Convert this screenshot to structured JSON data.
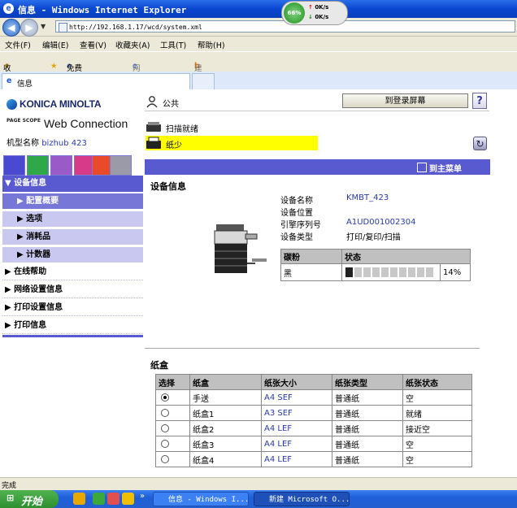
{
  "window": {
    "title": "信息 - Windows Internet Explorer",
    "address": "http://192.168.1.17/wcd/system.xml"
  },
  "speedmeter": {
    "percent": "66%",
    "up": "0K/s",
    "down": "0K/s"
  },
  "menu": [
    "文件(F)",
    "编辑(E)",
    "查看(V)",
    "收藏夹(A)",
    "工具(T)",
    "帮助(H)"
  ],
  "favorites": {
    "label": "收藏夹",
    "item1": "免费 Hotmail",
    "item2": "网页快讯库 ▾",
    "item3": "建议网站 ▾"
  },
  "tab": {
    "label": "信息"
  },
  "header": {
    "brand": "KONICA MINOLTA",
    "ps": "PAGE SCOPE",
    "wc": "Web Connection",
    "model_label": "机型名称",
    "model": "bizhub 423",
    "user": "公共",
    "login": "到登录屏幕",
    "help": "?"
  },
  "status": {
    "scan": "扫描就绪",
    "paper": "纸少"
  },
  "main_link": "到主菜单",
  "sidebar": {
    "device_info": "▼ 设备信息",
    "items": [
      "▶ 配置概要",
      "▶ 选项",
      "▶ 消耗品",
      "▶ 计数器"
    ],
    "online_help": "▶ 在线帮助",
    "network": "▶ 网络设置信息",
    "print_settings": "▶ 打印设置信息",
    "print_info": "▶ 打印信息"
  },
  "device": {
    "title": "设备信息",
    "fields": [
      {
        "label": "设备名称",
        "value": "KMBT_423"
      },
      {
        "label": "设备位置",
        "value": ""
      },
      {
        "label": "引擎序列号",
        "value": "A1UD001002304"
      },
      {
        "label": "设备类型",
        "value": "打印/复印/扫描"
      }
    ],
    "toner": {
      "h1": "碳粉",
      "h2": "状态",
      "color": "黑",
      "level": 0.14,
      "percent": "14%"
    }
  },
  "paper_tray": {
    "title": "纸盒",
    "headers": [
      "选择",
      "纸盒",
      "纸张大小",
      "纸张类型",
      "纸张状态"
    ],
    "rows": [
      {
        "tray": "手送",
        "size": "A4 SEF",
        "type": "普通纸",
        "state": "空",
        "selected": true
      },
      {
        "tray": "纸盒1",
        "size": "A3 SEF",
        "type": "普通纸",
        "state": "就绪",
        "selected": false
      },
      {
        "tray": "纸盒2",
        "size": "A4 LEF",
        "type": "普通纸",
        "state": "接近空",
        "selected": false
      },
      {
        "tray": "纸盒3",
        "size": "A4 LEF",
        "type": "普通纸",
        "state": "空",
        "selected": false
      },
      {
        "tray": "纸盒4",
        "size": "A4 LEF",
        "type": "普通纸",
        "state": "空",
        "selected": false
      }
    ]
  },
  "statusbar": "完成",
  "taskbar": {
    "start": "开始",
    "task1": "信息 - Windows I...",
    "task2": "新建 Microsoft O..."
  },
  "colors": {
    "accent": "#5a5ad0",
    "paper_warning": "#ffff00"
  }
}
